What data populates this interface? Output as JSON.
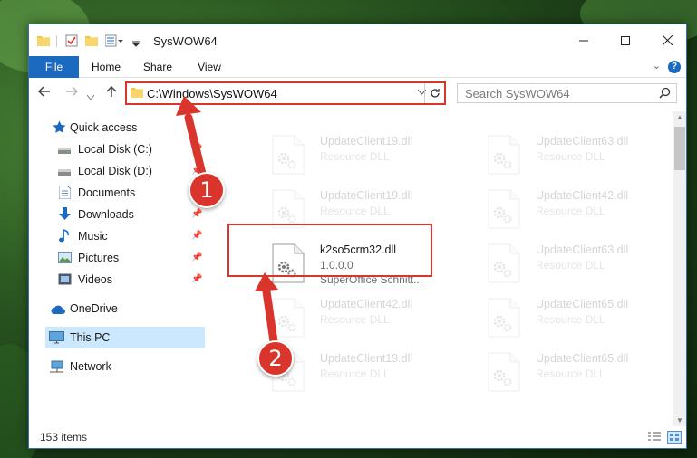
{
  "window": {
    "title": "SysWOW64"
  },
  "ribbon": {
    "tabs": [
      "File",
      "Home",
      "Share",
      "View"
    ]
  },
  "address": {
    "path": "C:\\Windows\\SysWOW64"
  },
  "search": {
    "placeholder": "Search SysWOW64"
  },
  "sidebar": {
    "items": [
      {
        "label": "Quick access",
        "icon": "star-icon",
        "pinned": false
      },
      {
        "label": "Local Disk (C:)",
        "icon": "drive-icon",
        "pinned": true
      },
      {
        "label": "Local Disk (D:)",
        "icon": "drive-icon",
        "pinned": true
      },
      {
        "label": "Documents",
        "icon": "documents-icon",
        "pinned": true
      },
      {
        "label": "Downloads",
        "icon": "downloads-icon",
        "pinned": true
      },
      {
        "label": "Music",
        "icon": "music-icon",
        "pinned": true
      },
      {
        "label": "Pictures",
        "icon": "pictures-icon",
        "pinned": true
      },
      {
        "label": "Videos",
        "icon": "videos-icon",
        "pinned": true
      },
      {
        "label": "OneDrive",
        "icon": "onedrive-icon",
        "pinned": false
      },
      {
        "label": "This PC",
        "icon": "this-pc-icon",
        "pinned": false,
        "selected": true
      },
      {
        "label": "Network",
        "icon": "network-icon",
        "pinned": false
      }
    ]
  },
  "files": {
    "left_column": [
      {
        "name": "UpdateClient19.dll",
        "type": "Resource DLL"
      },
      {
        "name": "UpdateClient19.dll",
        "type": "Resource DLL"
      },
      {
        "name": "k2so5crm32.dll",
        "version": "1.0.0.0",
        "company": "SuperOffice Schnitt...",
        "highlighted": true
      },
      {
        "name": "UpdateClient42.dll",
        "type": "Resource DLL"
      },
      {
        "name": "UpdateClient19.dll",
        "type": "Resource DLL"
      }
    ],
    "right_column": [
      {
        "name": "UpdateClient63.dll",
        "type": "Resource DLL"
      },
      {
        "name": "UpdateClient42.dll",
        "type": "Resource DLL"
      },
      {
        "name": "UpdateClient63.dll",
        "type": "Resource DLL"
      },
      {
        "name": "UpdateClient65.dll",
        "type": "Resource DLL"
      },
      {
        "name": "UpdateClient65.dll",
        "type": "Resource DLL"
      }
    ]
  },
  "status": {
    "item_count": "153 items"
  },
  "annotations": {
    "marker_1": "1",
    "marker_2": "2",
    "color": "#d9352c"
  },
  "colors": {
    "accent": "#1b6ac0",
    "selection": "#cce8ff",
    "annotation": "#d9352c"
  }
}
